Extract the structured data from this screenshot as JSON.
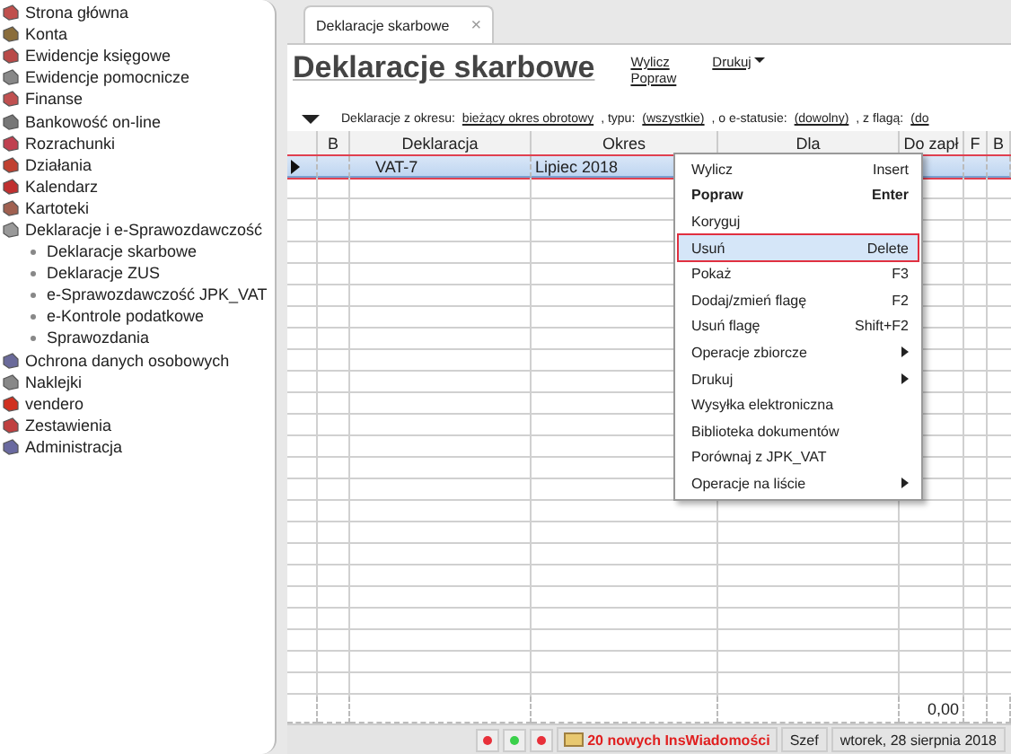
{
  "sidebar": {
    "items": [
      {
        "label": "Strona główna"
      },
      {
        "label": "Konta"
      },
      {
        "label": "Ewidencje księgowe"
      },
      {
        "label": "Ewidencje pomocnicze"
      },
      {
        "label": "Finanse"
      },
      {
        "label": "Bankowość on-line"
      },
      {
        "label": "Rozrachunki"
      },
      {
        "label": "Działania"
      },
      {
        "label": "Kalendarz"
      },
      {
        "label": "Kartoteki"
      },
      {
        "label": "Deklaracje i e-Sprawozdawczość",
        "children": [
          {
            "label": "Deklaracje skarbowe"
          },
          {
            "label": "Deklaracje ZUS"
          },
          {
            "label": "e-Sprawozdawczość JPK_VAT"
          },
          {
            "label": "e-Kontrole podatkowe"
          },
          {
            "label": "Sprawozdania"
          }
        ]
      },
      {
        "label": "Ochrona danych osobowych"
      },
      {
        "label": "Naklejki"
      },
      {
        "label": "vendero"
      },
      {
        "label": "Zestawienia"
      },
      {
        "label": "Administracja"
      }
    ]
  },
  "tabs": [
    {
      "label": "Deklaracje skarbowe",
      "selected": true,
      "close": "×"
    }
  ],
  "title": "Deklaracje skarbowe",
  "actions": [
    {
      "label": "Wylicz",
      "dropdown": false
    },
    {
      "label": "Drukuj",
      "dropdown": true
    },
    {
      "label": "Popraw",
      "dropdown": false
    }
  ],
  "filter": [
    {
      "kind": "text",
      "label": "Deklaracje z okresu:"
    },
    {
      "kind": "link",
      "label": "bieżący okres obrotowy"
    },
    {
      "kind": "text",
      "label": ", typu:"
    },
    {
      "kind": "link",
      "label": "(wszystkie)"
    },
    {
      "kind": "text",
      "label": ", o e-statusie:"
    },
    {
      "kind": "link",
      "label": "(dowolny)"
    },
    {
      "kind": "text",
      "label": ", z flagą:"
    },
    {
      "kind": "cut",
      "label": "(do"
    }
  ],
  "table": {
    "columns": [
      "B",
      "Deklaracja",
      "Okres",
      "Dla",
      "Do zapł",
      "F",
      "B"
    ],
    "rows": [
      {
        "selected": true,
        "deklaracja": "VAT-7",
        "okres": "Lipiec 2018"
      }
    ],
    "footer": {
      "do_zaplaty": "0,00"
    }
  },
  "context_menu": [
    {
      "label": "Wylicz",
      "shortcut": "Insert",
      "bold": false,
      "submenu": false,
      "selected": false
    },
    {
      "label": "Popraw",
      "shortcut": "Enter",
      "bold": true,
      "submenu": false,
      "selected": false
    },
    {
      "label": "Koryguj",
      "bold": false,
      "submenu": false,
      "selected": false
    },
    {
      "label": "Usuń",
      "shortcut": "Delete",
      "bold": false,
      "submenu": false,
      "selected": true
    },
    {
      "label": "Pokaż",
      "shortcut": "F3",
      "bold": false,
      "submenu": false,
      "selected": false
    },
    {
      "label": "Dodaj/zmień flagę",
      "shortcut": "F2",
      "bold": false,
      "submenu": false,
      "selected": false
    },
    {
      "label": "Usuń flagę",
      "shortcut": "Shift+F2",
      "bold": false,
      "submenu": false,
      "selected": false
    },
    {
      "label": "Operacje zbiorcze",
      "bold": false,
      "submenu": true,
      "selected": false
    },
    {
      "label": "Drukuj",
      "bold": false,
      "submenu": true,
      "selected": false
    },
    {
      "label": "Wysyłka elektroniczna",
      "bold": false,
      "submenu": false,
      "selected": false
    },
    {
      "label": "Biblioteka dokumentów",
      "bold": false,
      "submenu": false,
      "selected": false
    },
    {
      "label": "Porównaj z JPK_VAT",
      "bold": false,
      "submenu": false,
      "selected": false
    },
    {
      "label": "Operacje na liście",
      "bold": false,
      "submenu": true,
      "selected": false
    }
  ],
  "status_bar": {
    "lights": [
      {
        "color": "#e8303a"
      },
      {
        "color": "#3ad04a"
      },
      {
        "color": "#e8303a"
      }
    ],
    "messages": "20 nowych InsWiadomości",
    "user": "Szef",
    "date": "wtorek, 28 sierpnia 2018"
  }
}
